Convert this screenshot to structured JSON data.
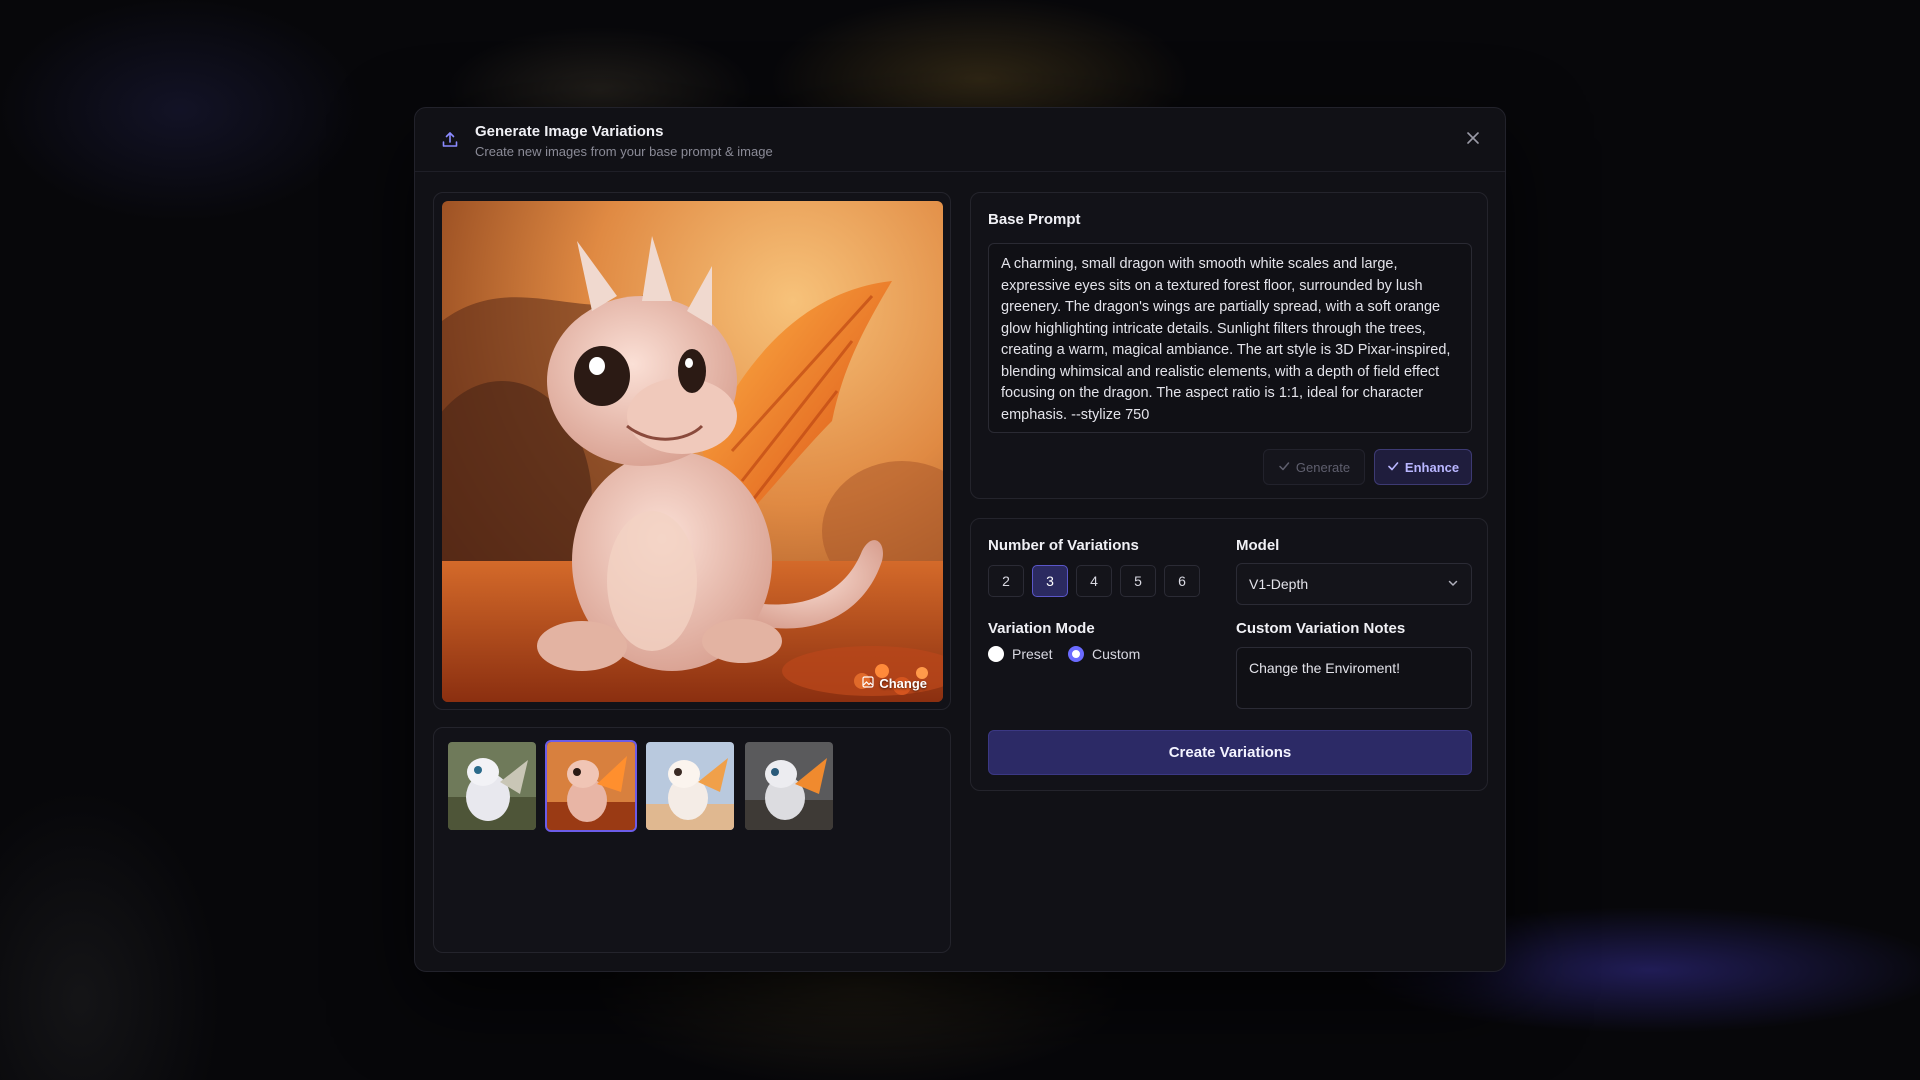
{
  "modal": {
    "title": "Generate Image Variations",
    "subtitle": "Create new images from your base prompt & image",
    "icons": {
      "header": "upload-icon",
      "close": "close-icon"
    }
  },
  "image": {
    "change_label": "Change",
    "change_icon": "image-icon"
  },
  "thumbnails": [
    {
      "name": "thumbnail-1",
      "selected": false,
      "theme": "forest"
    },
    {
      "name": "thumbnail-2",
      "selected": true,
      "theme": "sunset"
    },
    {
      "name": "thumbnail-3",
      "selected": false,
      "theme": "sky"
    },
    {
      "name": "thumbnail-4",
      "selected": false,
      "theme": "ruins"
    }
  ],
  "prompt": {
    "label": "Base Prompt",
    "text": "A charming, small dragon with smooth white scales and large, expressive eyes sits on a textured forest floor, surrounded by lush greenery. The dragon's wings are partially spread, with a soft orange glow highlighting intricate details. Sunlight filters through the trees, creating a warm, magical ambiance. The art style is 3D Pixar-inspired, blending whimsical and realistic elements, with a depth of field effect focusing on the dragon. The aspect ratio is 1:1, ideal for character emphasis. --stylize 750",
    "generate_label": "Generate",
    "enhance_label": "Enhance"
  },
  "variations": {
    "label": "Number of Variations",
    "options": [
      "2",
      "3",
      "4",
      "5",
      "6"
    ],
    "selected": "3"
  },
  "model": {
    "label": "Model",
    "value": "V1-Depth"
  },
  "mode": {
    "label": "Variation Mode",
    "preset_label": "Preset",
    "custom_label": "Custom",
    "selected": "Custom"
  },
  "notes": {
    "label": "Custom Variation Notes",
    "value": "Change the Enviroment!"
  },
  "create_label": "Create Variations",
  "colors": {
    "accent": "#6c5ce7",
    "button": "#2c2a66",
    "panel": "#121218"
  }
}
